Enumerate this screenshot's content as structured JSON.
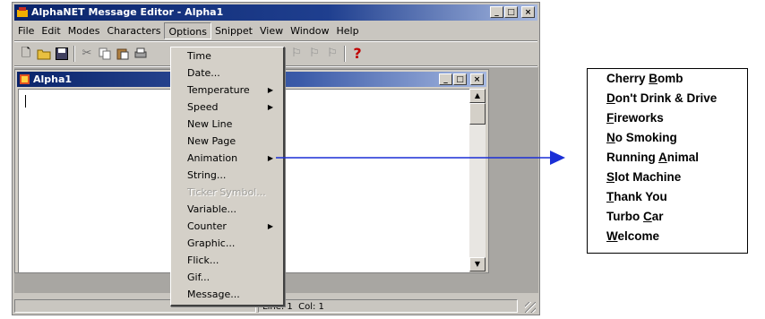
{
  "app": {
    "title": "AlphaNET Message Editor - Alpha1",
    "menu": [
      "File",
      "Edit",
      "Modes",
      "Characters",
      "Options",
      "Snippet",
      "View",
      "Window",
      "Help"
    ],
    "window_buttons": [
      "_",
      "□",
      "×"
    ]
  },
  "child_window": {
    "title": "Alpha1",
    "buttons": [
      "_",
      "□",
      "×"
    ]
  },
  "options_menu": {
    "items": [
      {
        "label": "Time",
        "submenu": false,
        "disabled": false
      },
      {
        "label": "Date...",
        "submenu": false,
        "disabled": false
      },
      {
        "label": "Temperature",
        "submenu": true,
        "disabled": false
      },
      {
        "label": "Speed",
        "submenu": true,
        "disabled": false
      },
      {
        "label": "New Line",
        "submenu": false,
        "disabled": false
      },
      {
        "label": "New Page",
        "submenu": false,
        "disabled": false
      },
      {
        "label": "Animation",
        "submenu": true,
        "disabled": false
      },
      {
        "label": "String...",
        "submenu": false,
        "disabled": false
      },
      {
        "label": "Ticker Symbol...",
        "submenu": false,
        "disabled": true
      },
      {
        "label": "Variable...",
        "submenu": false,
        "disabled": false
      },
      {
        "label": "Counter",
        "submenu": true,
        "disabled": false
      },
      {
        "label": "Graphic...",
        "submenu": false,
        "disabled": false
      },
      {
        "label": "Flick...",
        "submenu": false,
        "disabled": false
      },
      {
        "label": "Gif...",
        "submenu": false,
        "disabled": false
      },
      {
        "label": "Message...",
        "submenu": false,
        "disabled": false
      }
    ]
  },
  "status": {
    "line": "Line: 1",
    "col": "Col: 1"
  },
  "animation_submenu": {
    "items": [
      {
        "pre": "Cherry ",
        "ul": "B",
        "post": "omb"
      },
      {
        "pre": "",
        "ul": "D",
        "post": "on't Drink & Drive"
      },
      {
        "pre": "",
        "ul": "F",
        "post": "ireworks"
      },
      {
        "pre": "",
        "ul": "N",
        "post": "o Smoking"
      },
      {
        "pre": "Running ",
        "ul": "A",
        "post": "nimal"
      },
      {
        "pre": "",
        "ul": "S",
        "post": "lot Machine"
      },
      {
        "pre": "",
        "ul": "T",
        "post": "hank You"
      },
      {
        "pre": "Turbo ",
        "ul": "C",
        "post": "ar"
      },
      {
        "pre": "",
        "ul": "W",
        "post": "elcome"
      }
    ]
  },
  "colors": {
    "titlebar": "#0a246a",
    "pointer_arrow": "#1a2fd6"
  }
}
